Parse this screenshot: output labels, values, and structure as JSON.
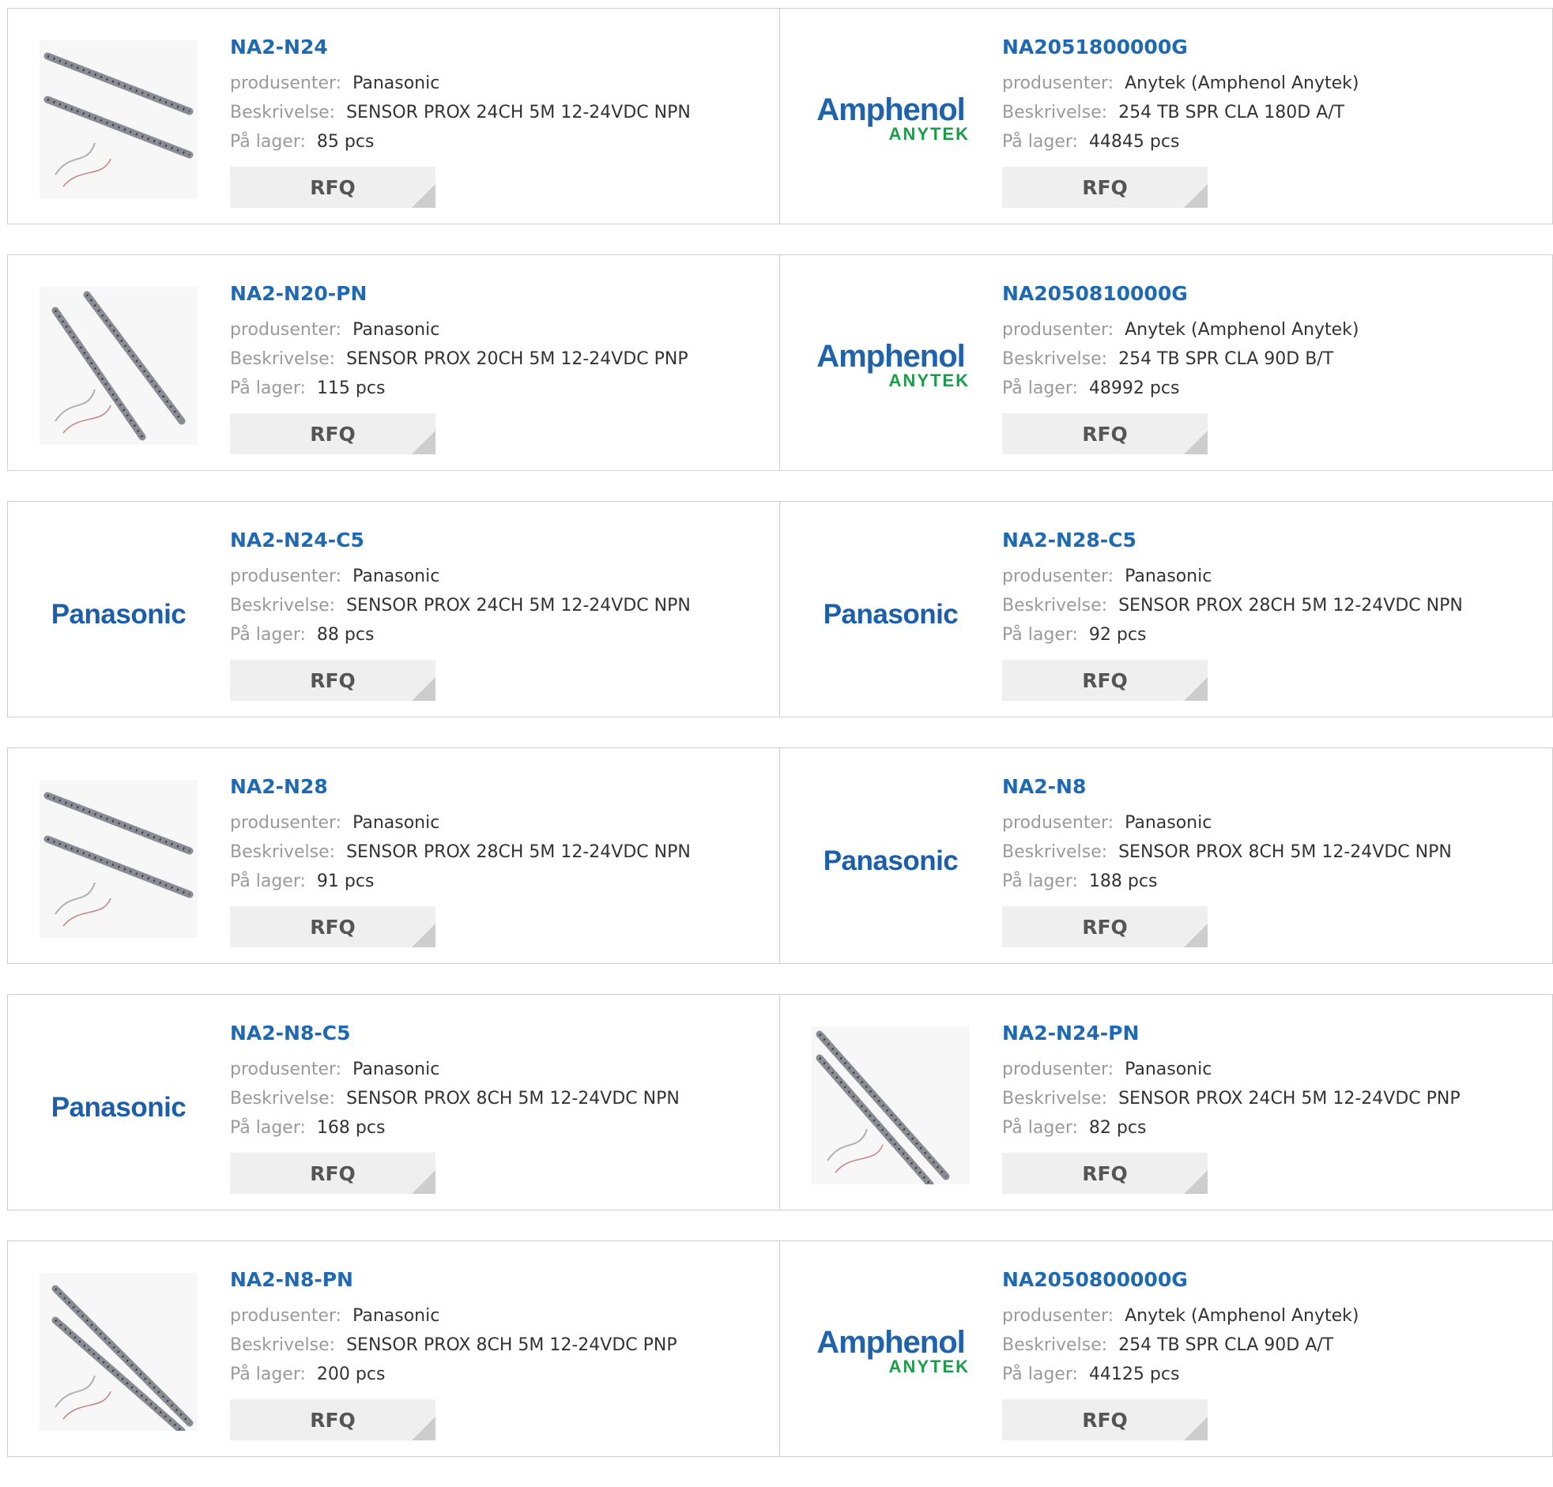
{
  "labels": {
    "manufacturer": "produsenter:",
    "description": "Beskrivelse:",
    "stock": "På lager:",
    "rfq": "RFQ"
  },
  "brands": {
    "panasonic_logo": "Panasonic",
    "amphenol_logo_main": "Amphenol",
    "amphenol_logo_sub": "ANYTEK"
  },
  "colors": {
    "title_blue": "#1f69b3",
    "panasonic_blue": "#1d5eab",
    "amphenol_blue": "#1f63ad",
    "anytek_green": "#1c9c4a"
  },
  "products": [
    {
      "part": "NA2-N24",
      "manufacturer": "Panasonic",
      "description": "SENSOR PROX 24CH 5M 12-24VDC NPN",
      "stock": "85 pcs",
      "image": "sensor-bar-photo-icon"
    },
    {
      "part": "NA2051800000G",
      "manufacturer": "Anytek (Amphenol Anytek)",
      "description": "254 TB SPR CLA 180D A/T",
      "stock": "44845 pcs",
      "image": "amphenol-anytek-logo"
    },
    {
      "part": "NA2-N20-PN",
      "manufacturer": "Panasonic",
      "description": "SENSOR PROX 20CH 5M 12-24VDC PNP",
      "stock": "115 pcs",
      "image": "sensor-bar-photo-icon"
    },
    {
      "part": "NA2050810000G",
      "manufacturer": "Anytek (Amphenol Anytek)",
      "description": "254 TB SPR CLA 90D B/T",
      "stock": "48992 pcs",
      "image": "amphenol-anytek-logo"
    },
    {
      "part": "NA2-N24-C5",
      "manufacturer": "Panasonic",
      "description": "SENSOR PROX 24CH 5M 12-24VDC NPN",
      "stock": "88 pcs",
      "image": "panasonic-logo"
    },
    {
      "part": "NA2-N28-C5",
      "manufacturer": "Panasonic",
      "description": "SENSOR PROX 28CH 5M 12-24VDC NPN",
      "stock": "92 pcs",
      "image": "panasonic-logo"
    },
    {
      "part": "NA2-N28",
      "manufacturer": "Panasonic",
      "description": "SENSOR PROX 28CH 5M 12-24VDC NPN",
      "stock": "91 pcs",
      "image": "sensor-bar-photo-icon"
    },
    {
      "part": "NA2-N8",
      "manufacturer": "Panasonic",
      "description": "SENSOR PROX 8CH 5M 12-24VDC NPN",
      "stock": "188 pcs",
      "image": "panasonic-logo"
    },
    {
      "part": "NA2-N8-C5",
      "manufacturer": "Panasonic",
      "description": "SENSOR PROX 8CH 5M 12-24VDC NPN",
      "stock": "168 pcs",
      "image": "panasonic-logo"
    },
    {
      "part": "NA2-N24-PN",
      "manufacturer": "Panasonic",
      "description": "SENSOR PROX 24CH 5M 12-24VDC PNP",
      "stock": "82 pcs",
      "image": "sensor-bar-photo-icon"
    },
    {
      "part": "NA2-N8-PN",
      "manufacturer": "Panasonic",
      "description": "SENSOR PROX 8CH 5M 12-24VDC PNP",
      "stock": "200 pcs",
      "image": "sensor-bar-photo-icon"
    },
    {
      "part": "NA2050800000G",
      "manufacturer": "Anytek (Amphenol Anytek)",
      "description": "254 TB SPR CLA 90D A/T",
      "stock": "44125 pcs",
      "image": "amphenol-anytek-logo"
    }
  ]
}
